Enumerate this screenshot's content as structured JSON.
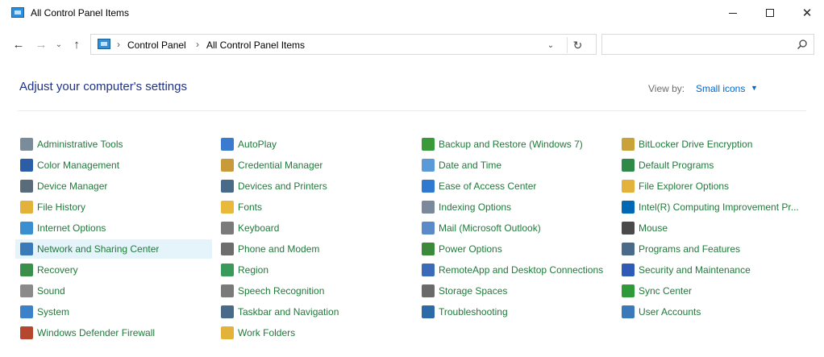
{
  "window": {
    "title": "All Control Panel Items",
    "min_label": "–",
    "close_label": "✕"
  },
  "nav": {
    "back_glyph": "←",
    "forward_glyph": "→",
    "recent_glyph": "⌄",
    "up_glyph": "↑",
    "breadcrumb": [
      "Control Panel",
      "All Control Panel Items"
    ],
    "separator": "›",
    "dropdown_glyph": "⌄",
    "refresh_glyph": "↻"
  },
  "search": {
    "placeholder": ""
  },
  "header": {
    "title": "Adjust your computer's settings",
    "view_by_label": "View by:",
    "view_by_value": "Small icons",
    "view_by_arrow": "▼"
  },
  "colors": {
    "item_text": "#1f7a3a",
    "heading": "#1e3287",
    "link": "#0066cc",
    "highlight": "#e5f3fb"
  },
  "items": [
    {
      "label": "Administrative Tools",
      "icon": "admin-tools-icon",
      "color": "#7a8c99"
    },
    {
      "label": "Color Management",
      "icon": "color-management-icon",
      "color": "#2c5ea8"
    },
    {
      "label": "Device Manager",
      "icon": "device-manager-icon",
      "color": "#5a6b7a"
    },
    {
      "label": "File History",
      "icon": "file-history-icon",
      "color": "#e2b23a"
    },
    {
      "label": "Internet Options",
      "icon": "internet-options-icon",
      "color": "#3a8fd0"
    },
    {
      "label": "Network and Sharing Center",
      "icon": "network-sharing-icon",
      "color": "#3a7ab8",
      "highlighted": true
    },
    {
      "label": "Recovery",
      "icon": "recovery-icon",
      "color": "#3a8f4a"
    },
    {
      "label": "Sound",
      "icon": "sound-icon",
      "color": "#8a8a8a"
    },
    {
      "label": "System",
      "icon": "system-icon",
      "color": "#3b82c8"
    },
    {
      "label": "Windows Defender Firewall",
      "icon": "firewall-icon",
      "color": "#b5472f"
    },
    {
      "label": "AutoPlay",
      "icon": "autoplay-icon",
      "color": "#3a7bd0"
    },
    {
      "label": "Credential Manager",
      "icon": "credential-manager-icon",
      "color": "#c99a3a"
    },
    {
      "label": "Devices and Printers",
      "icon": "devices-printers-icon",
      "color": "#4a6a8a"
    },
    {
      "label": "Fonts",
      "icon": "fonts-icon",
      "color": "#e8b93a"
    },
    {
      "label": "Keyboard",
      "icon": "keyboard-icon",
      "color": "#7a7a7a"
    },
    {
      "label": "Phone and Modem",
      "icon": "phone-modem-icon",
      "color": "#6d6d6d"
    },
    {
      "label": "Region",
      "icon": "region-icon",
      "color": "#3a9a5a"
    },
    {
      "label": "Speech Recognition",
      "icon": "speech-recognition-icon",
      "color": "#7a7a7a"
    },
    {
      "label": "Taskbar and Navigation",
      "icon": "taskbar-icon",
      "color": "#4a6a8a"
    },
    {
      "label": "Work Folders",
      "icon": "work-folders-icon",
      "color": "#e2b23a"
    },
    {
      "label": "Backup and Restore (Windows 7)",
      "icon": "backup-restore-icon",
      "color": "#3a9a3a"
    },
    {
      "label": "Date and Time",
      "icon": "date-time-icon",
      "color": "#5a9ad8"
    },
    {
      "label": "Ease of Access Center",
      "icon": "ease-of-access-icon",
      "color": "#2f7ad0"
    },
    {
      "label": "Indexing Options",
      "icon": "indexing-options-icon",
      "color": "#7a8a9a"
    },
    {
      "label": "Mail (Microsoft Outlook)",
      "icon": "mail-icon",
      "color": "#5a8ac8"
    },
    {
      "label": "Power Options",
      "icon": "power-options-icon",
      "color": "#3a8a3a"
    },
    {
      "label": "RemoteApp and Desktop Connections",
      "icon": "remoteapp-icon",
      "color": "#3a6ab8"
    },
    {
      "label": "Storage Spaces",
      "icon": "storage-spaces-icon",
      "color": "#6a6a6a"
    },
    {
      "label": "Troubleshooting",
      "icon": "troubleshooting-icon",
      "color": "#2f6aa8"
    },
    {
      "label": "BitLocker Drive Encryption",
      "icon": "bitlocker-icon",
      "color": "#c9a23a"
    },
    {
      "label": "Default Programs",
      "icon": "default-programs-icon",
      "color": "#2f8a4a"
    },
    {
      "label": "File Explorer Options",
      "icon": "file-explorer-options-icon",
      "color": "#e2b23a"
    },
    {
      "label": "Intel(R) Computing Improvement Pr...",
      "icon": "intel-icon",
      "color": "#0068b5"
    },
    {
      "label": "Mouse",
      "icon": "mouse-icon",
      "color": "#4a4a4a"
    },
    {
      "label": "Programs and Features",
      "icon": "programs-features-icon",
      "color": "#4a6a8a"
    },
    {
      "label": "Security and Maintenance",
      "icon": "security-maintenance-icon",
      "color": "#2f5ab8"
    },
    {
      "label": "Sync Center",
      "icon": "sync-center-icon",
      "color": "#2f9a3a"
    },
    {
      "label": "User Accounts",
      "icon": "user-accounts-icon",
      "color": "#3a7ab8"
    }
  ]
}
